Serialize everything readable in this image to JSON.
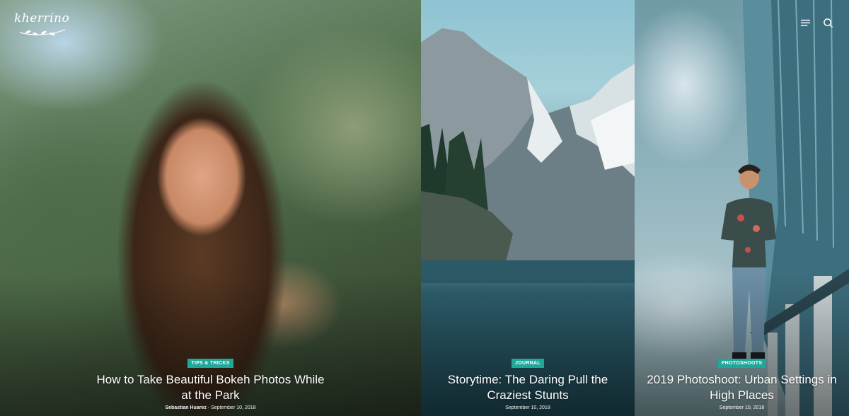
{
  "site": {
    "logo_text": "kherrino"
  },
  "header": {
    "menu_icon": "menu-icon",
    "search_icon": "search-icon"
  },
  "posts": [
    {
      "category": "TIPS & TRICKS",
      "title": "How to Take Beautiful Bokeh Photos While at the Park",
      "author": "Sebastian Huarez",
      "separator": "-",
      "date": "September 10, 2018"
    },
    {
      "category": "JOURNAL",
      "title": "Storytime: The Daring Pull the Craziest Stunts",
      "date": "September 10, 2018"
    },
    {
      "category": "PHOTOSHOOTS",
      "title": "2019 Photoshoot: Urban Settings in High Places",
      "date": "September 10, 2018"
    }
  ],
  "colors": {
    "accent": "#1ea89a"
  }
}
